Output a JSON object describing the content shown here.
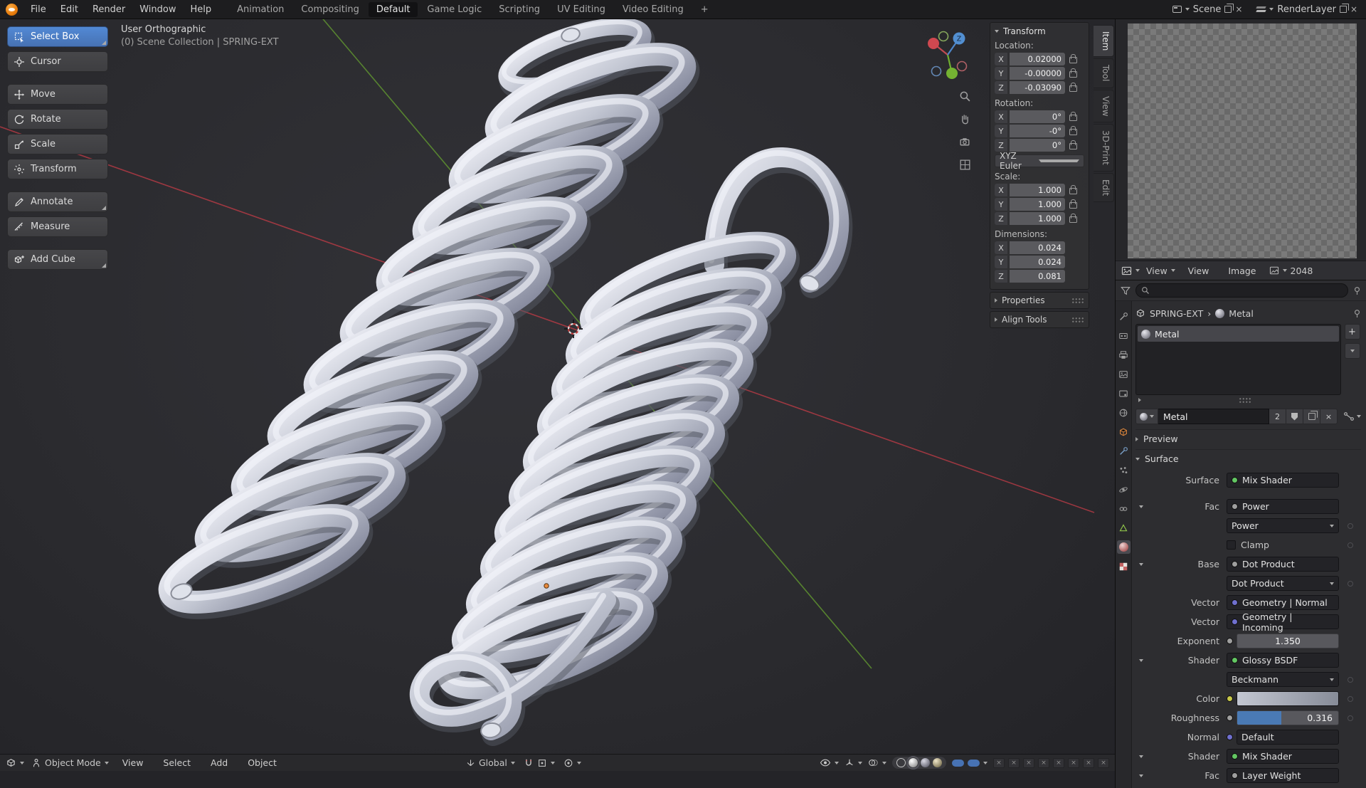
{
  "icons": {
    "close": "×",
    "plus": "+",
    "breadcrumb_separator": "›"
  },
  "colors": {
    "accent": "#4772b3",
    "active_tool": "#4772b3",
    "axis_x": "#c14b52",
    "axis_y": "#6fae2f",
    "axis_z": "#4e86c9",
    "socket_shader": "#63c763",
    "socket_vector": "#7070cf",
    "socket_value": "#9f9f9f",
    "socket_color": "#c9c94a",
    "spring_body": "#c3c7d2",
    "roughness_fill": "#4a7ab5"
  },
  "topbar": {
    "menus": [
      {
        "label": "File"
      },
      {
        "label": "Edit"
      },
      {
        "label": "Render"
      },
      {
        "label": "Window"
      },
      {
        "label": "Help"
      }
    ],
    "tabs": [
      {
        "label": "Animation"
      },
      {
        "label": "Compositing"
      },
      {
        "label": "Default"
      },
      {
        "label": "Game Logic"
      },
      {
        "label": "Scripting"
      },
      {
        "label": "UV Editing"
      },
      {
        "label": "Video Editing"
      },
      {
        "label": "+"
      }
    ],
    "active_tab": "Default",
    "scene_label": "Scene",
    "renderlayer_label": "RenderLayer"
  },
  "toolbar": {
    "active_tool": "Select Box",
    "tools": [
      {
        "label": "Select Box"
      },
      {
        "label": "Cursor"
      },
      {
        "label": "Move"
      },
      {
        "label": "Rotate"
      },
      {
        "label": "Scale"
      },
      {
        "label": "Transform"
      },
      {
        "label": "Annotate"
      },
      {
        "label": "Measure"
      },
      {
        "label": "Add Cube"
      }
    ]
  },
  "viewport": {
    "view_label": "User Orthographic",
    "collection_label": "(0) Scene Collection | SPRING-EXT",
    "gizmo_axis_label": "Z"
  },
  "npanel": {
    "title": "Transform",
    "location": {
      "label": "Location:",
      "rows": [
        {
          "axis": "X",
          "value": "0.02000"
        },
        {
          "axis": "Y",
          "value": "-0.00000"
        },
        {
          "axis": "Z",
          "value": "-0.03090"
        }
      ]
    },
    "rotation": {
      "label": "Rotation:",
      "mode": "XYZ Euler",
      "rows": [
        {
          "axis": "X",
          "value": "0°"
        },
        {
          "axis": "Y",
          "value": "-0°"
        },
        {
          "axis": "Z",
          "value": "0°"
        }
      ]
    },
    "scale": {
      "label": "Scale:",
      "rows": [
        {
          "axis": "X",
          "value": "1.000"
        },
        {
          "axis": "Y",
          "value": "1.000"
        },
        {
          "axis": "Z",
          "value": "1.000"
        }
      ]
    },
    "dimensions": {
      "label": "Dimensions:",
      "rows": [
        {
          "axis": "X",
          "value": "0.024"
        },
        {
          "axis": "Y",
          "value": "0.024"
        },
        {
          "axis": "Z",
          "value": "0.081"
        }
      ]
    },
    "collapsed_sections": [
      {
        "label": "Properties"
      },
      {
        "label": "Align Tools"
      }
    ]
  },
  "side_tabs": [
    {
      "label": "Item"
    },
    {
      "label": "Tool"
    },
    {
      "label": "View"
    },
    {
      "label": "3D-Print"
    },
    {
      "label": "Edit"
    }
  ],
  "image_editor": {
    "mode_menu": "View",
    "view_menu": "View",
    "image_menu": "Image",
    "datablock": "2048"
  },
  "properties": {
    "breadcrumb": {
      "object": "SPRING-EXT",
      "material": "Metal"
    },
    "slots": [
      {
        "name": "Metal"
      }
    ],
    "datablock": {
      "name": "Metal",
      "users": "2"
    },
    "preview_label": "Preview",
    "surface_label": "Surface",
    "surface": {
      "label": "Surface",
      "value": "Mix Shader"
    },
    "fac": {
      "label": "Fac",
      "value": "Power"
    },
    "power_menu": "Power",
    "clamp_label": "Clamp",
    "base": {
      "label": "Base",
      "value": "Dot Product"
    },
    "dot_menu": "Dot Product",
    "vector1": {
      "label": "Vector",
      "value": "Geometry | Normal"
    },
    "vector2": {
      "label": "Vector",
      "value": "Geometry | Incoming"
    },
    "exponent": {
      "label": "Exponent",
      "value": "1.350"
    },
    "shader1": {
      "label": "Shader",
      "value": "Glossy BSDF"
    },
    "distribution_menu": "Beckmann",
    "color_label": "Color",
    "roughness": {
      "label": "Roughness",
      "value": "0.316",
      "fraction": 0.44
    },
    "normal": {
      "label": "Normal",
      "value": "Default"
    },
    "shader2": {
      "label": "Shader",
      "value": "Mix Shader"
    },
    "fac2": {
      "label": "Fac",
      "value": "Layer Weight"
    }
  },
  "footer": {
    "mode": "Object Mode",
    "menus": [
      {
        "label": "View"
      },
      {
        "label": "Select"
      },
      {
        "label": "Add"
      },
      {
        "label": "Object"
      }
    ],
    "orientation": "Global"
  }
}
